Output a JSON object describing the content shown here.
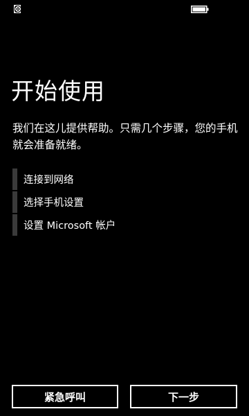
{
  "status_bar": {
    "left_icon": "network-indicator-icon",
    "right_icon": "battery-icon"
  },
  "page": {
    "title": "开始使用",
    "intro": "我们在这儿提供帮助。只需几个步骤，您的手机就会准备就绪。"
  },
  "steps": [
    {
      "label": "连接到网络"
    },
    {
      "label": "选择手机设置"
    },
    {
      "label": "设置 Microsoft 帐户"
    }
  ],
  "buttons": {
    "emergency_label": "紧急呼叫",
    "next_label": "下一步"
  },
  "colors": {
    "background": "#000000",
    "text": "#ffffff",
    "step_bar": "#3a3a3a"
  }
}
